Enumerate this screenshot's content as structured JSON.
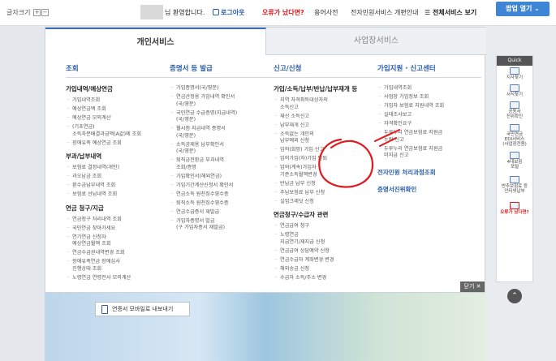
{
  "header": {
    "font_size_label": "글자크기",
    "font_plus": "+",
    "font_minus": "−",
    "welcome": "님 환영합니다.",
    "logout": "로그아웃",
    "error_report": "오류가 났다면?",
    "glossary": "용어사전",
    "portal_info": "전자민원서비스 개편안내",
    "all_services": "전체서비스 보기",
    "popup": "팝업 열기"
  },
  "tabs": {
    "personal": "개인서비스",
    "business": "사업장서비스"
  },
  "columns": {
    "inquiry": {
      "title": "조회",
      "sections": [
        {
          "name": "가입내역/예상연금",
          "items": [
            "가입내역조회",
            "예상연금액 조회",
            "예상연금 모의계산",
            "(기초연금)\n소득자분배결과금액(A값)에 조회",
            "장애유족 예상연금 조회"
          ]
        },
        {
          "name": "부과/납부내역",
          "items": [
            "보험료 결정내역(개인)",
            "과오납금 조회",
            "환수금납부내역 조회",
            "보험료 선납내역 조회"
          ]
        },
        {
          "name": "연금 청구/지급",
          "items": [
            "연금청구 처리내역 조회",
            "국민연금 찾아가세요",
            "연기연금 신청자\n예상연금월액 조회",
            "연금수급권내역변경 조회",
            "장애유족연금 장애심사\n진행상태 조회",
            "노령연금 연령전사 모의계산"
          ]
        }
      ]
    },
    "certificate": {
      "title": "증명서 등 발급",
      "items": [
        "가입증명서(국/영문)",
        "연금산정용 가입내역 확인서\n(국/영문)",
        "국민연금 수급증명(지급내역)\n(국/영문)",
        "월시점 지급내역 증명서\n(국/영문)",
        "소득공제용 납부확인서\n(국/영문)",
        "퇴직금전환금 부과내역\n조회/증명",
        "가입확인서(해외연금)",
        "가입기간계산신청서 확인서",
        "연금소득 원천징수영수증",
        "퇴직소득 원천징수영수증",
        "연금수급증서 재발급",
        "가입자증명서 발급\n(구 가입자증서 재발급)"
      ]
    },
    "apply": {
      "title": "신고/신청",
      "sections": [
        {
          "name": "가입/소득/납부/반납/납부재개 등",
          "items": [
            "지역 자격취득대상자의\n소득신고",
            "재산 소득신고",
            "납부재개 신고",
            "소득없는 개인의\n납부예외 신청",
            "임의(희망) 가입 신고",
            "임의가입(자)가입 탈퇴",
            "임의(계속)가입자\n기준소득월액변경",
            "반납금 납부 신청",
            "추납보험료 납부 신청",
            "실업크레딧 신청"
          ]
        },
        {
          "name": "연금청구/수급자 관련",
          "items": [
            "연금급여 청구",
            "노령연금\n지급연기/재지급 신청",
            "연금급여 상담예약 신청",
            "연금수급자 계좌변경 변경",
            "해외송금 신청",
            "수급자 소득/주소 변경"
          ]
        }
      ]
    },
    "support": {
      "title": "가입지원 · 신고센터",
      "items": [
        "가입내역조회",
        "사업장 가입정보 조회",
        "가입자 보험료 지원내역 조회",
        "실태조사보고",
        "자격확인요구",
        "두루누리 연금보험료 지원금\n누락 신고",
        "두루누리 연금보험료 지원금\n미지급 신고"
      ],
      "blue_sections": [
        "전자민원 처리과정조회",
        "증명서진위확인"
      ]
    }
  },
  "close_label": "닫기",
  "close_x": "✕",
  "quick": {
    "header": "Quick",
    "items": [
      "지사찾기",
      "서식찾기",
      "공동서\n진위확인",
      "국민연금\nEDI서비스\n(사업장전용)",
      "4대보험\n포털",
      "반추보험료 등\n인터넷납부"
    ],
    "error_label": "오류가 났다면?"
  },
  "up_arrow": "⌃",
  "mobile_button": "연증서 모바일로 내보내기",
  "colors": {
    "accent": "#2a5da8",
    "annotation": "#e0191e",
    "popup": "#3f85d6"
  }
}
